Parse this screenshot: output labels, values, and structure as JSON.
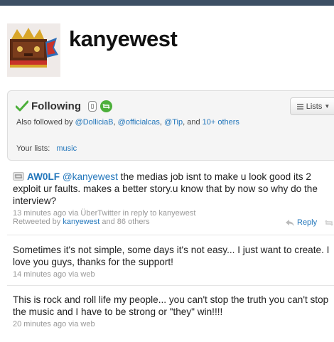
{
  "profile": {
    "username": "kanyewest"
  },
  "follow_box": {
    "following_label": "Following",
    "also_followed_prefix": "Also followed by",
    "also_followed_users": [
      "@DolliciaB",
      "@officialcas",
      "@Tip"
    ],
    "also_followed_sep": ",",
    "also_followed_and": ", and",
    "also_followed_others": "10+ others",
    "lists_button": "Lists",
    "your_lists_label": "Your lists:",
    "your_lists_value": "music"
  },
  "tweets": [
    {
      "retweet_author": "AW0LF",
      "mention": "@kanyewest",
      "text": " the medias job isnt to make u look good its 2 exploit ur faults. makes a better story.u know that by now so why do the interview?",
      "meta": "13 minutes ago via ÜberTwitter in reply to kanyewest",
      "retweeted_by_prefix": "Retweeted by",
      "retweeted_by_user": "kanyewest",
      "retweeted_by_suffix": "and 86 others",
      "reply_label": "Reply"
    },
    {
      "text": "Sometimes it's not simple, some days it's not easy... I just want to create. I love you guys, thanks for the support!",
      "meta": "14 minutes ago via web"
    },
    {
      "text": "This is rock and roll life my people... you can't stop the truth you can't stop the music and I have to be strong or \"they\" win!!!!",
      "meta": "20 minutes ago via web"
    }
  ],
  "colors": {
    "link": "#2276bb",
    "follow_check": "#4caf3a",
    "header_strip": "#3d4f64"
  },
  "icons": [
    "check-icon",
    "device-updates-icon",
    "retweet-toggle-icon",
    "lists-icon",
    "retweet-icon",
    "reply-icon"
  ]
}
